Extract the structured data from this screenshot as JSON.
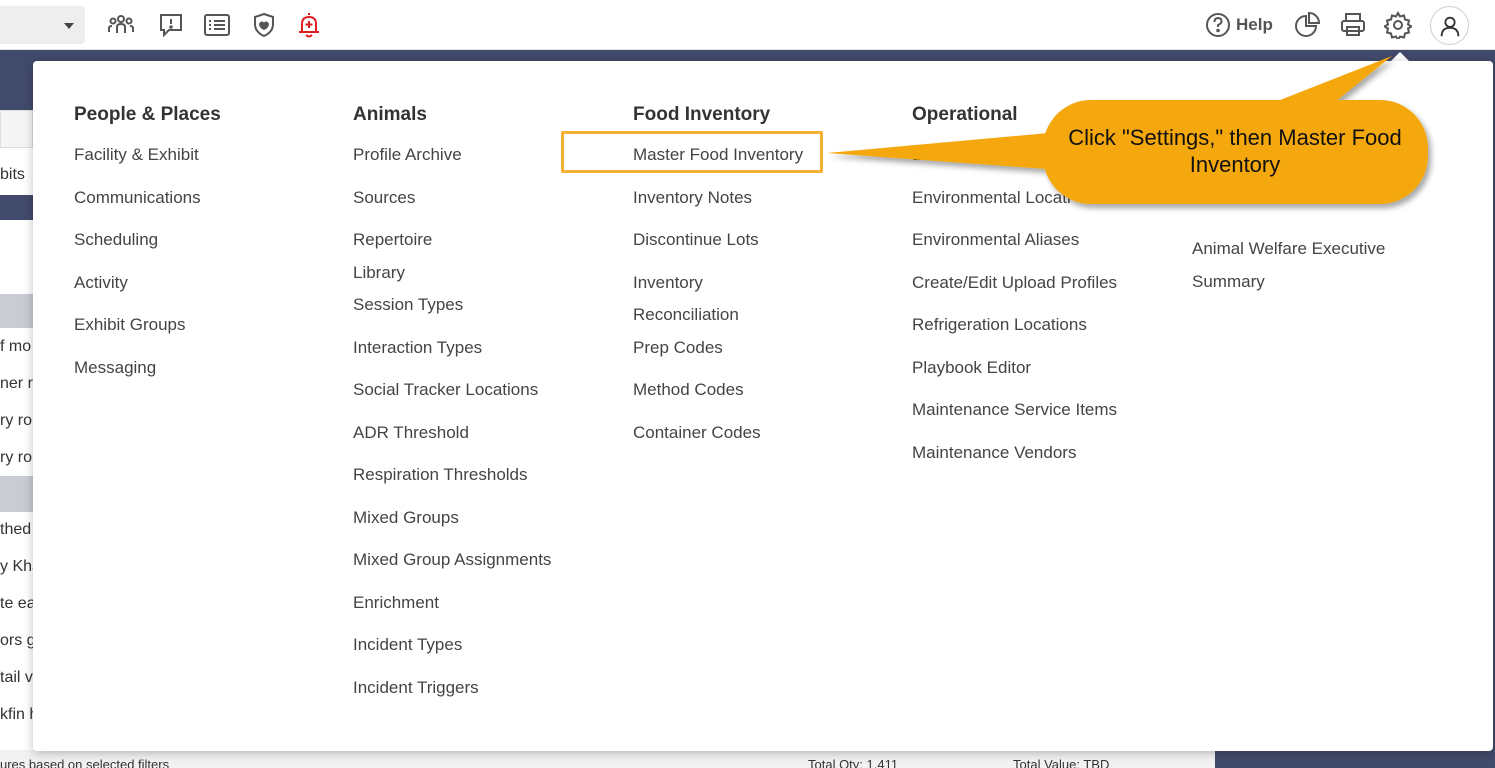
{
  "topbar": {
    "icons": [
      "people-icon",
      "alert-icon",
      "list-icon",
      "shield-icon",
      "alarm-bell-icon",
      "help-icon",
      "pie-chart-icon",
      "printer-icon",
      "gear-icon",
      "user-icon"
    ],
    "help_label": "Help",
    "alarm_color": "#e02020"
  },
  "background": {
    "rows": [
      "bits",
      "f mo",
      "ner ro",
      "ry ro",
      "ry ro",
      "thed",
      "y Kha",
      "te ea",
      "ors g",
      "tail v",
      "kfin h"
    ],
    "footer_left": "ures based on selected filters",
    "footer_qty": "Total Qty: 1,411",
    "footer_value": "Total Value: TBD"
  },
  "menu": {
    "people_places": {
      "heading": "People & Places",
      "items": [
        "Facility & Exhibit",
        "Communications",
        "Scheduling",
        "Activity",
        "Exhibit Groups",
        "Messaging"
      ]
    },
    "animals": {
      "heading": "Animals",
      "items": [
        "Profile Archive",
        "Sources",
        "Repertoire Library",
        "Session Types",
        "Interaction Types",
        "Social Tracker Locations",
        "ADR Threshold",
        "Respiration Thresholds",
        "Mixed Groups",
        "Mixed Group Assignments",
        "Enrichment",
        "Incident Types",
        "Incident Triggers"
      ]
    },
    "food_inventory": {
      "heading": "Food Inventory",
      "items": [
        "Master Food Inventory",
        "Inventory Notes",
        "Discontinue Lots",
        "Inventory Reconciliation",
        "Prep Codes",
        "Method Codes",
        "Container Codes"
      ]
    },
    "operational": {
      "heading": "Operational",
      "items": [
        "E",
        "Environmental Locati",
        "Environmental Aliases",
        "Create/Edit Upload Profiles",
        "Refrigeration Locations",
        "Playbook Editor",
        "Maintenance Service Items",
        "Maintenance Vendors"
      ]
    },
    "col5": {
      "items": [
        "Animal Welfare Executive Summary"
      ]
    }
  },
  "callout": {
    "text": "Click \"Settings,\" then Master Food Inventory",
    "color": "#f5a80b"
  }
}
